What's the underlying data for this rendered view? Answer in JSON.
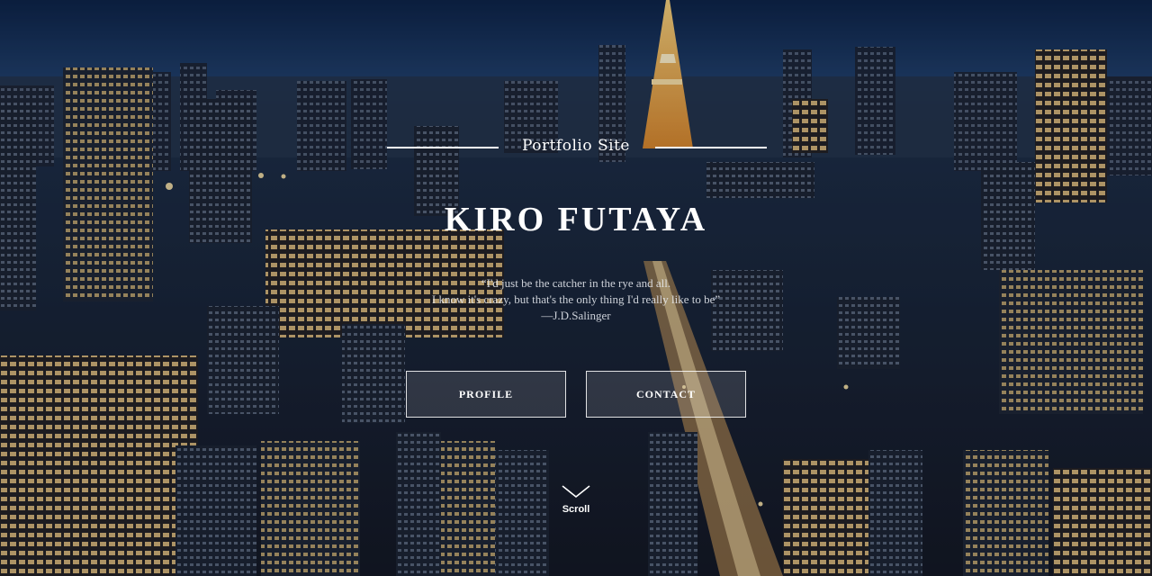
{
  "hero": {
    "subtitle": "Portfolio Site",
    "title": "KIRO FUTAYA",
    "quote_lines": [
      "“I'd just be the catcher in the rye and all.",
      "I know it's crazy, but that's the only thing I'd really like to be”",
      "—J.D.Salinger"
    ],
    "buttons": {
      "profile": "PROFILE",
      "contact": "CONTACT"
    },
    "scroll_label": "Scroll",
    "scroll_icon": "chevron-down-icon"
  },
  "colors": {
    "sky_top": "#0d2548",
    "city_dark": "#16202f",
    "tower": "#e8a23a",
    "text": "#ffffff"
  }
}
